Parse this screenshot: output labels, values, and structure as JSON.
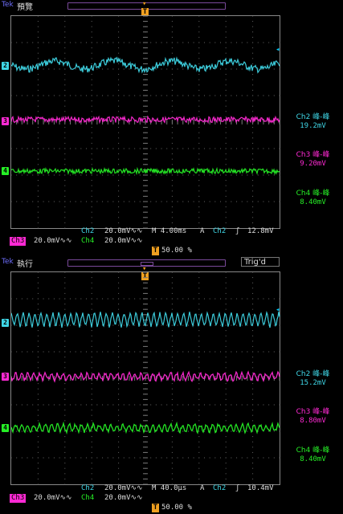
{
  "colors": {
    "ch2": "#3fd6e6",
    "ch3": "#ff2ad4",
    "ch4": "#26ee26",
    "trigger": "#f0a020",
    "tek": "#6f6fff"
  },
  "panel_top": {
    "brand": "Tek",
    "state": "預覽",
    "measurements": [
      {
        "name": "Ch2 峰-峰",
        "value": "19.2mV"
      },
      {
        "name": "Ch3 峰-峰",
        "value": "9.20mV"
      },
      {
        "name": "Ch4 峰-峰",
        "value": "8.40mV"
      }
    ],
    "status_line1": {
      "ch": "Ch2",
      "scale": "20.0mV",
      "timebase": "M 4.00ms",
      "mode": "A",
      "trig_ch": "Ch2",
      "trig_level": "12.8mV"
    },
    "status_line2": {
      "ch3": "Ch3",
      "ch3_scale": "20.0mV",
      "ch4": "Ch4",
      "ch4_scale": "20.0mV"
    },
    "trigger_position": "50.00 %"
  },
  "panel_bottom": {
    "brand": "Tek",
    "state": "執行",
    "trig_status": "Trig'd",
    "measurements": [
      {
        "name": "Ch2 峰-峰",
        "value": "15.2mV"
      },
      {
        "name": "Ch3 峰-峰",
        "value": "8.80mV"
      },
      {
        "name": "Ch4 峰-峰",
        "value": "8.40mV"
      }
    ],
    "status_line1": {
      "ch": "Ch2",
      "scale": "20.0mV",
      "timebase": "M 40.0µs",
      "mode": "A",
      "trig_ch": "Ch2",
      "trig_level": "10.4mV"
    },
    "status_line2": {
      "ch3": "Ch3",
      "ch3_scale": "20.0mV",
      "ch4": "Ch4",
      "ch4_scale": "20.0mV"
    },
    "trigger_position": "50.00 %"
  },
  "channel_markers": [
    "2",
    "3",
    "4"
  ],
  "trigger_marker": "T"
}
